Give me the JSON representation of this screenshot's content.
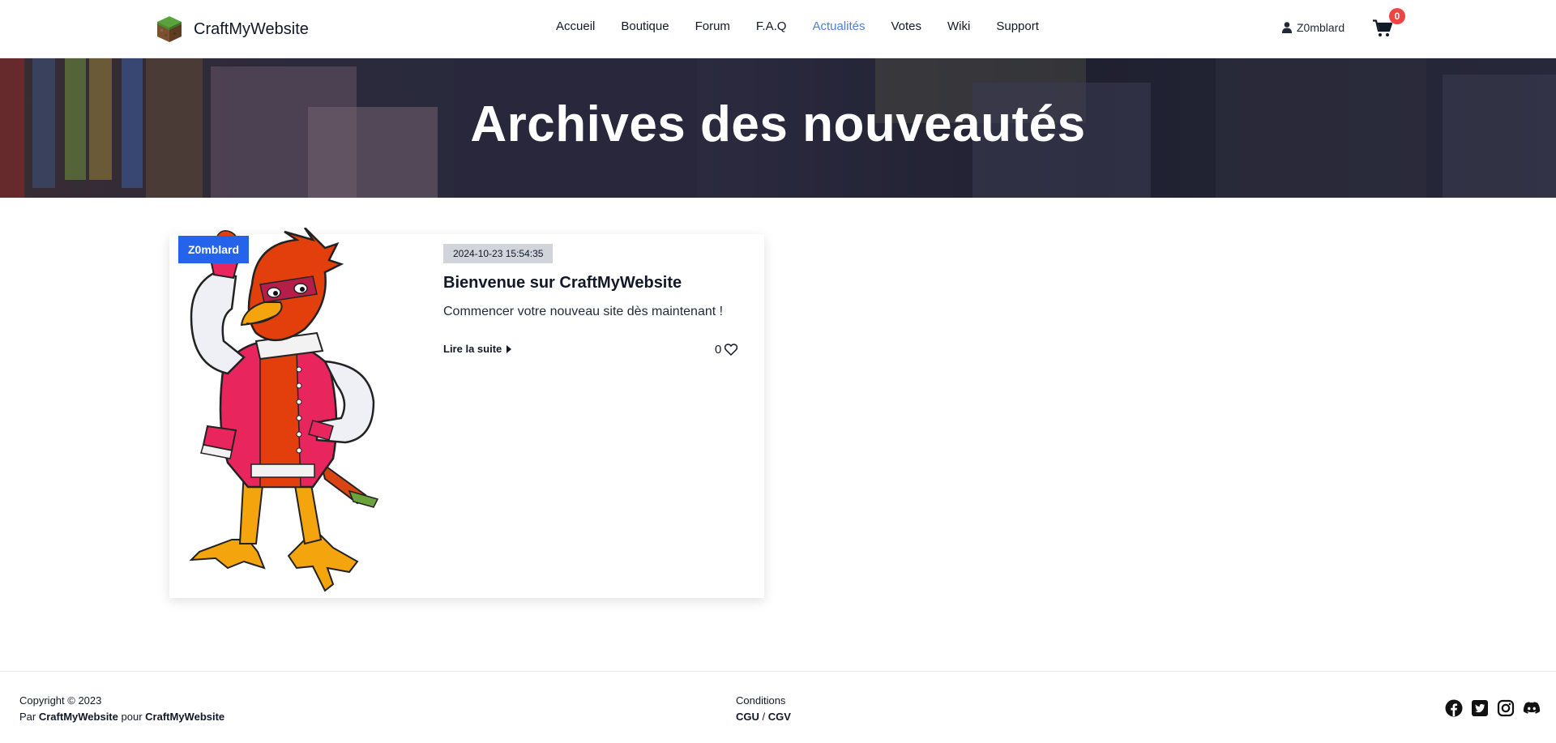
{
  "header": {
    "brand": "CraftMyWebsite",
    "nav": [
      {
        "label": "Accueil",
        "active": false
      },
      {
        "label": "Boutique",
        "active": false
      },
      {
        "label": "Forum",
        "active": false
      },
      {
        "label": "F.A.Q",
        "active": false
      },
      {
        "label": "Actualités",
        "active": true
      },
      {
        "label": "Votes",
        "active": false
      },
      {
        "label": "Wiki",
        "active": false
      },
      {
        "label": "Support",
        "active": false
      }
    ],
    "user": "Z0mblard",
    "cart_count": "0",
    "icons": {
      "user": "user-icon",
      "cart": "cart-icon",
      "logo": "grass-block-logo"
    }
  },
  "hero": {
    "title": "Archives des nouveautés"
  },
  "post": {
    "author": "Z0mblard",
    "date": "2024-10-23 15:54:35",
    "title": "Bienvenue sur CraftMyWebsite",
    "description": "Commencer votre nouveau site dès maintenant !",
    "read_more": "Lire la suite",
    "likes": "0",
    "icons": {
      "read_more": "caret-right-icon",
      "likes": "heart-icon",
      "image": "phoenix-mascot"
    }
  },
  "footer": {
    "copyright": "Copyright © 2023",
    "by_prefix": "Par",
    "by_author": "CraftMyWebsite",
    "for_word": "pour",
    "for_site": "CraftMyWebsite",
    "conditions_title": "Conditions",
    "cgu": "CGU",
    "separator": "/",
    "cgv": "CGV",
    "socials": [
      "facebook-icon",
      "twitter-icon",
      "instagram-icon",
      "discord-icon"
    ]
  },
  "colors": {
    "active_nav": "#4f7fd6",
    "badge_blue": "#2563eb",
    "cart_badge": "#ef4444",
    "date_bg": "#d1d5db"
  }
}
